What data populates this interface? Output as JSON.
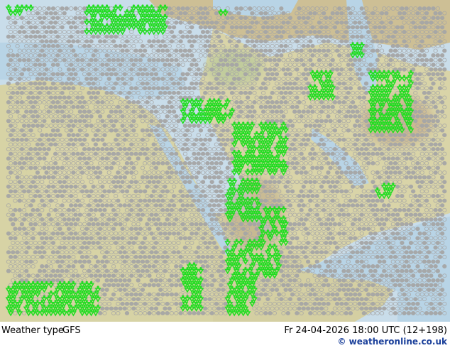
{
  "footer": {
    "parameter": "Weather type",
    "model": "GFS",
    "valid_time": "Fr 24-04-2026 18:00 UTC (12+198)",
    "credit_symbol": "©",
    "credit": "weatheronline.co.uk"
  },
  "colors": {
    "sea": "#bcd8e8",
    "land_low": "#d6d2a4",
    "land_high": "#c7b690",
    "land_green": "#a8c49a",
    "rain_symbol": "#22dd22",
    "cloud_symbol": "#a6a6a6"
  },
  "icons": [
    "rain-shower-symbol",
    "overcast-symbol",
    "cloudy-symbol"
  ]
}
